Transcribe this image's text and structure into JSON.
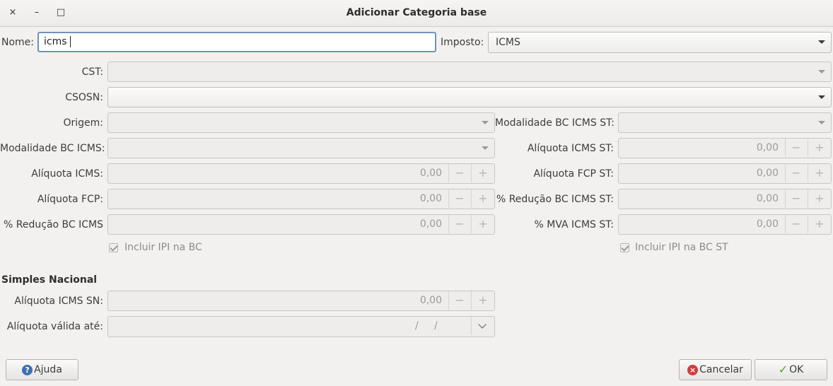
{
  "window": {
    "title": "Adicionar Categoria base",
    "close_glyph": "×",
    "min_glyph": "–",
    "max_glyph": "□"
  },
  "form": {
    "nome_label": "Nome:",
    "nome_value": "icms",
    "imposto_label": "Imposto:",
    "imposto_value": "ICMS",
    "cst_label": "CST:",
    "csosn_label": "CSOSN:",
    "origem_label": "Origem:",
    "mod_bc_icms_st_label": "Modalidade BC ICMS ST:",
    "mod_bc_icms_label": "Modalidade BC ICMS:",
    "aliq_icms_st_label": "Alíquota ICMS ST:",
    "aliq_icms_st_value": "0,00",
    "aliq_icms_label": "Alíquota ICMS:",
    "aliq_icms_value": "0,00",
    "aliq_fcp_st_label": "Alíquota FCP ST:",
    "aliq_fcp_st_value": "0,00",
    "aliq_fcp_label": "Alíquota FCP:",
    "aliq_fcp_value": "0,00",
    "red_bc_icms_st_label": "% Redução BC ICMS ST:",
    "red_bc_icms_st_value": "0,00",
    "red_bc_icms_label": "% Redução BC ICMS",
    "red_bc_icms_value": "0,00",
    "mva_icms_st_label": "% MVA ICMS ST:",
    "mva_icms_st_value": "0,00",
    "incluir_ipi_bc_label": "Incluir IPI na BC",
    "incluir_ipi_bc_st_label": "Incluir IPI na BC ST",
    "incluir_ipi_bc_checked": true,
    "incluir_ipi_bc_st_checked": true,
    "spin_minus": "−",
    "spin_plus": "+"
  },
  "simples": {
    "section_title": "Simples Nacional",
    "aliq_icms_sn_label": "Alíquota ICMS SN:",
    "aliq_icms_sn_value": "0,00",
    "aliq_valida_label": "Alíquota válida até:",
    "date_slash": "/"
  },
  "buttons": {
    "help_label": "Ajuda",
    "help_icon": "?",
    "cancel_label": "Cancelar",
    "cancel_icon": "×",
    "ok_label": "OK",
    "ok_icon": "✓"
  },
  "colors": {
    "focus_border": "#6f93c0",
    "help_icon": "#3d6fb0",
    "cancel_icon": "#d33b3b",
    "ok_icon": "#5a9e2a"
  }
}
